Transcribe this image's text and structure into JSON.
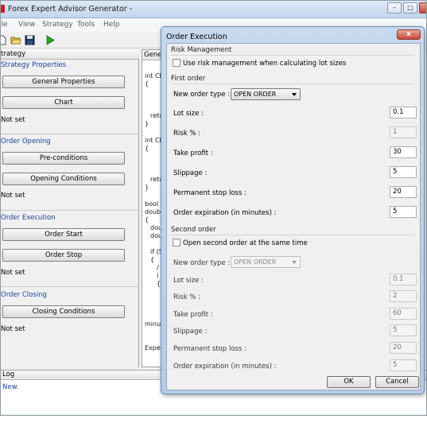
{
  "app": {
    "title": "Forex Expert Advisor Generator -"
  },
  "menu": [
    "ile",
    "View",
    "Strategy",
    "Tools",
    "Help"
  ],
  "strategy_panel": {
    "header": "trategy",
    "sections": [
      {
        "label": "Strategy Properties",
        "buttons": [
          "General Properties",
          "Chart"
        ],
        "status": "Not set"
      },
      {
        "label": "Order Opening",
        "buttons": [
          "Pre-conditions",
          "Opening Conditions"
        ],
        "status": "Not set"
      },
      {
        "label": "Order Execution",
        "buttons": [
          "Order Start",
          "Order Stop"
        ],
        "status": "Not set"
      },
      {
        "label": "Order Closing",
        "buttons": [
          "Closing Conditions"
        ],
        "status": "Not set"
      }
    ]
  },
  "code_panel": {
    "header": "Gener",
    "lines": [
      "int Ch",
      "{",
      "retu",
      "}",
      "int Ch",
      "{",
      "retu",
      "}",
      "bool C",
      "double",
      "{",
      "dou",
      "dou",
      "if (S",
      "{",
      "/",
      "i",
      "{",
      "minut",
      "Exper"
    ]
  },
  "log_panel": {
    "header": "Log",
    "text": "New."
  },
  "dialog": {
    "title": "Order Execution",
    "close_glyph": "x",
    "risk_management": {
      "title": "Risk Management",
      "checkbox_label": "Use risk management when calculating lot sizes"
    },
    "first_order": {
      "title": "First order",
      "order_type_label": "New order type :",
      "order_type_value": "OPEN ORDER",
      "lot_size_label": "Lot size :",
      "lot_size": "0.1",
      "risk_label": "Risk % :",
      "risk": "1",
      "take_profit_label": "Take profit :",
      "take_profit": "30",
      "slippage_label": "Slippage :",
      "slippage": "5",
      "stop_loss_label": "Permanent stop loss :",
      "stop_loss": "20",
      "expiration_label": "Order expiration (in minutes) :",
      "expiration": "5"
    },
    "second_order": {
      "title": "Second order",
      "checkbox_label": "Open second order at the same time",
      "order_type_label": "New order type :",
      "order_type_value": "OPEN ORDER",
      "lot_size_label": "Lot size :",
      "lot_size": "0.1",
      "risk_label": "Risk % :",
      "risk": "2",
      "take_profit_label": "Take profit :",
      "take_profit": "60",
      "slippage_label": "Slippage :",
      "slippage": "5",
      "stop_loss_label": "Permanent stop loss :",
      "stop_loss": "20",
      "expiration_label": "Order expiration (in minutes) :",
      "expiration": "5"
    },
    "ok_label": "OK",
    "cancel_label": "Cancel"
  },
  "colors": {
    "section_label": "#1a44a0",
    "title_bar": "#c3d6ec",
    "close_button": "#c4473a"
  },
  "icons": [
    "app-icon",
    "new-file-icon",
    "open-folder-icon",
    "save-icon",
    "run-icon"
  ]
}
